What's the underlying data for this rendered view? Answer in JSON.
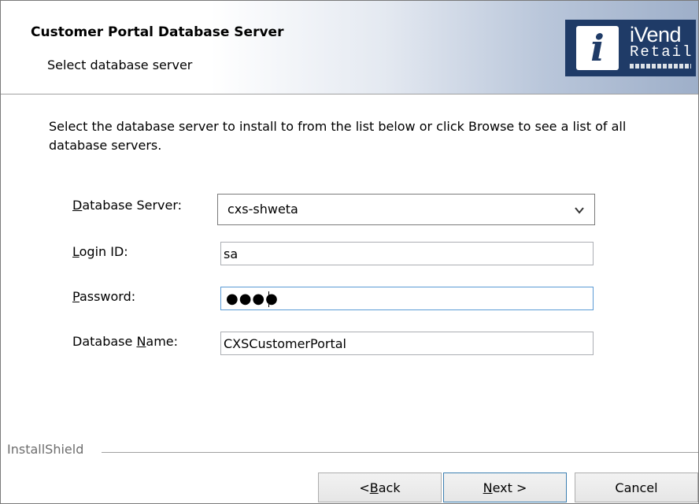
{
  "header": {
    "title": "Customer Portal Database Server",
    "subtitle": "Select database server",
    "logo": {
      "word1": "iVend",
      "word2": "Retail",
      "mark": "i"
    }
  },
  "instructions": "Select the database server to install to from the list below or click Browse to see a list of all database servers.",
  "form": {
    "database_server": {
      "label_pre": "",
      "label_u": "D",
      "label_post": "atabase Server:",
      "value": "cxs-shweta"
    },
    "login_id": {
      "label_pre": "",
      "label_u": "L",
      "label_post": "ogin ID:",
      "value": "sa"
    },
    "password": {
      "label_pre": "",
      "label_u": "P",
      "label_post": "assword:",
      "dots": "●●●●"
    },
    "database_name": {
      "label_pre": "Database ",
      "label_u": "N",
      "label_post": "ame:",
      "value": "CXSCustomerPortal"
    }
  },
  "footer": {
    "brand": "InstallShield",
    "back": {
      "pre": "< ",
      "u": "B",
      "post": "ack"
    },
    "next": {
      "pre": "",
      "u": "N",
      "post": "ext >"
    },
    "cancel": "Cancel"
  },
  "colors": {
    "logo_bg": "#1f3b67",
    "focus_border": "#5b9bd5"
  }
}
